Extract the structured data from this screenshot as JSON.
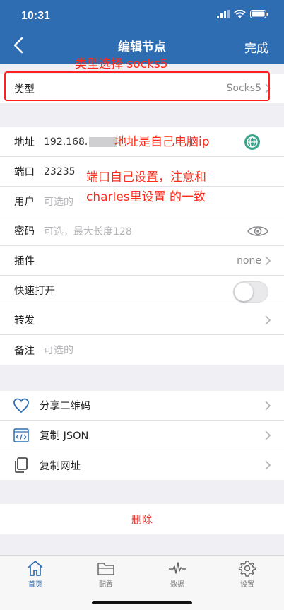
{
  "status_bar": {
    "time": "10:31"
  },
  "nav": {
    "title": "编辑节点",
    "done": "完成"
  },
  "annotations": {
    "type": "类型选择 socks5",
    "address": "地址是自己电脑ip",
    "port_line1": "端口自己设置，注意和",
    "port_line2": "charles里设置 的一致"
  },
  "type_row": {
    "label": "类型",
    "value": "Socks5"
  },
  "form": {
    "address": {
      "label": "地址",
      "value": "192.168."
    },
    "port": {
      "label": "端口",
      "value": "23235"
    },
    "user": {
      "label": "用户",
      "placeholder": "可选的"
    },
    "password": {
      "label": "密码",
      "placeholder": "可选，最大长度128"
    },
    "plugin": {
      "label": "插件",
      "value": "none"
    },
    "quick_open": {
      "label": "快速打开",
      "enabled": false
    },
    "forward": {
      "label": "转发"
    },
    "note": {
      "label": "备注",
      "placeholder": "可选的"
    }
  },
  "share": {
    "qr": "分享二维码",
    "json": "复制 JSON",
    "url": "复制网址"
  },
  "delete": "删除",
  "tabs": [
    {
      "label": "首页",
      "icon": "home-icon",
      "active": true
    },
    {
      "label": "配置",
      "icon": "folder-icon",
      "active": false
    },
    {
      "label": "数据",
      "icon": "pulse-icon",
      "active": false
    },
    {
      "label": "设置",
      "icon": "gear-icon",
      "active": false
    }
  ],
  "colors": {
    "accent": "#2f6db3",
    "annotation": "#ff2a1a",
    "delete": "#e0322c"
  }
}
